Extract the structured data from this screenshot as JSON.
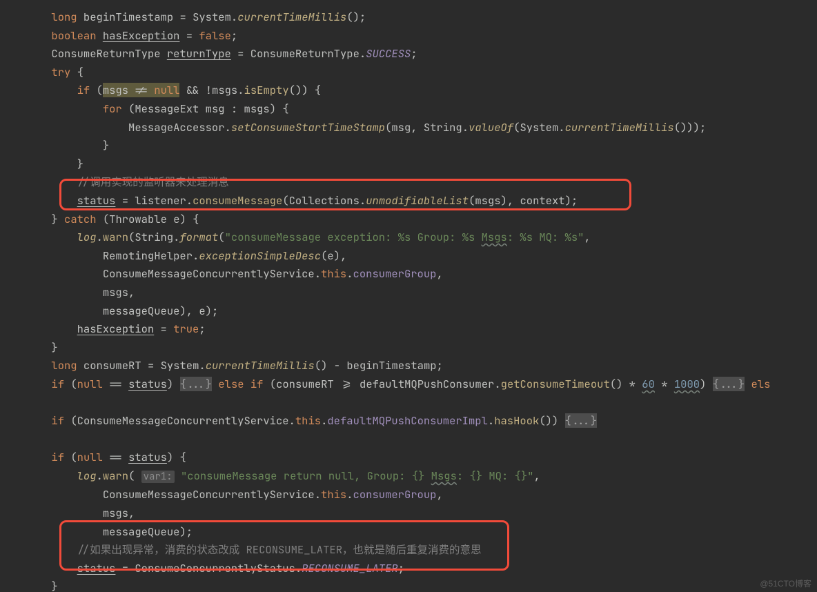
{
  "code": {
    "l1": {
      "kw1": "long",
      "id1": "beginTimestamp",
      "eq": "=",
      "cls": "System",
      "dot": ".",
      "m": "currentTimeMillis",
      "rest": "();"
    },
    "l2": {
      "kw1": "boolean",
      "id1": "hasException",
      "eq": "=",
      "kw2": "false",
      "semi": ";"
    },
    "l3": {
      "cls1": "ConsumeReturnType",
      "id1": "returnType",
      "eq": "=",
      "cls2": "ConsumeReturnType",
      "dot": ".",
      "cst": "SUCCESS",
      "semi": ";"
    },
    "l4": {
      "kw": "try",
      "brace": "{"
    },
    "l5": {
      "kw1": "if",
      "lp": "(",
      "id1": "msgs",
      "op": "!=",
      "kw2": "null",
      "and": "&&",
      "neg": "!",
      "id2": "msgs",
      "dot": ".",
      "m": "isEmpty",
      "rp": "()) {"
    },
    "l6": {
      "kw1": "for",
      "lp": "(",
      "cls": "MessageExt",
      "id1": "msg",
      "colon": ":",
      "id2": "msgs",
      "rp": ") {"
    },
    "l7": {
      "cls": "MessageAccessor",
      "dot": ".",
      "m1": "setConsumeStartTimeStamp",
      "lp": "(",
      "id1": "msg",
      "c1": ",",
      "cls2": "String",
      "dot2": ".",
      "m2": "valueOf",
      "lp2": "(",
      "cls3": "System",
      "dot3": ".",
      "m3": "currentTimeMillis",
      "rest": "()));"
    },
    "l8": {
      "brace": "}"
    },
    "l9": {
      "brace": "}"
    },
    "l10": {
      "cmt": "//调用实现的监听器来处理消息"
    },
    "l11": {
      "id1": "status",
      "eq": "=",
      "id2": "listener",
      "dot": ".",
      "m1": "consumeMessage",
      "lp": "(",
      "cls": "Collections",
      "dot2": ".",
      "m2": "unmodifiableList",
      "lp2": "(",
      "id3": "msgs",
      "rp2": "),",
      "id4": "context",
      "rp": ");"
    },
    "l12": {
      "brace": "}",
      "kw": "catch",
      "lp": "(",
      "cls": "Throwable",
      "id": "e",
      "rp": ") {"
    },
    "l13": {
      "id1": "log",
      "dot": ".",
      "m1": "warn",
      "lp": "(",
      "cls": "String",
      "dot2": ".",
      "m2": "format",
      "lp2": "(",
      "str": "\"consumeMessage exception: %s Group: %s ",
      "strwavy": "Msgs",
      "str2": ": %s MQ: %s\"",
      "c": ","
    },
    "l14": {
      "cls": "RemotingHelper",
      "dot": ".",
      "m": "exceptionSimpleDesc",
      "lp": "(",
      "id": "e",
      "rp": "),"
    },
    "l15": {
      "cls": "ConsumeMessageConcurrentlyService",
      "dot": ".",
      "kw": "this",
      "dot2": ".",
      "fld": "consumerGroup",
      "c": ","
    },
    "l16": {
      "id": "msgs",
      "c": ","
    },
    "l17": {
      "id": "messageQueue",
      "rp": "),",
      "id2": "e",
      "rp2": ");"
    },
    "l18": {
      "id1": "hasException",
      "eq": "=",
      "kw": "true",
      "semi": ";"
    },
    "l19": {
      "brace": "}"
    },
    "l20": {
      "kw": "long",
      "id1": "consumeRT",
      "eq": "=",
      "cls": "System",
      "dot": ".",
      "m": "currentTimeMillis",
      "rp": "()",
      "op": "-",
      "id2": "beginTimestamp",
      "semi": ";"
    },
    "l21": {
      "kw1": "if",
      "lp": "(",
      "kw2": "null",
      "op": "==",
      "id1": "status",
      "rp": ")",
      "fold1": "{...}",
      "kw3": "else if",
      "lp2": "(",
      "id2": "consumeRT",
      "op2": ">=",
      "id3": "defaultMQPushConsumer",
      "dot": ".",
      "m": "getConsumeTimeout",
      "rp2": "()",
      "op3": "*",
      "n1": "60",
      "op4": "*",
      "n2": "1000",
      "rp3": ")",
      "fold2": "{...}",
      "kw4": "els"
    },
    "l22": "",
    "l23": {
      "kw1": "if",
      "lp": "(",
      "cls": "ConsumeMessageConcurrentlyService",
      "dot": ".",
      "kw2": "this",
      "dot2": ".",
      "fld": "defaultMQPushConsumerImpl",
      "dot3": ".",
      "m": "hasHook",
      "rp": "())",
      "fold": "{...}"
    },
    "l24": "",
    "l25": {
      "kw1": "if",
      "lp": "(",
      "kw2": "null",
      "op": "==",
      "id": "status",
      "rp": ") {"
    },
    "l26": {
      "id1": "log",
      "dot": ".",
      "m": "warn",
      "lp": "(",
      "hint": "var1:",
      "sp": " ",
      "str": "\"consumeMessage return null, Group: {} ",
      "strwavy": "Msgs",
      "str2": ": {} MQ: {}\"",
      "c": ","
    },
    "l27": {
      "cls": "ConsumeMessageConcurrentlyService",
      "dot": ".",
      "kw": "this",
      "dot2": ".",
      "fld": "consumerGroup",
      "c": ","
    },
    "l28": {
      "id": "msgs",
      "c": ","
    },
    "l29": {
      "id": "messageQueue",
      "rp": ");"
    },
    "l30": {
      "cmt": "//如果出现异常，消费的状态改成 RECONSUME_LATER，也就是随后重复消费的意思"
    },
    "l31": {
      "id1": "status",
      "eq": "=",
      "cls": "ConsumeConcurrentlyStatus",
      "dot": ".",
      "cst": "RECONSUME_LATER",
      "semi": ";"
    },
    "l32": {
      "brace": "}"
    }
  },
  "watermark": "@51CTO博客",
  "indent": {
    "i2": "        ",
    "i3": "            ",
    "i4": "                ",
    "i5": "                    ",
    "cont": "                "
  }
}
